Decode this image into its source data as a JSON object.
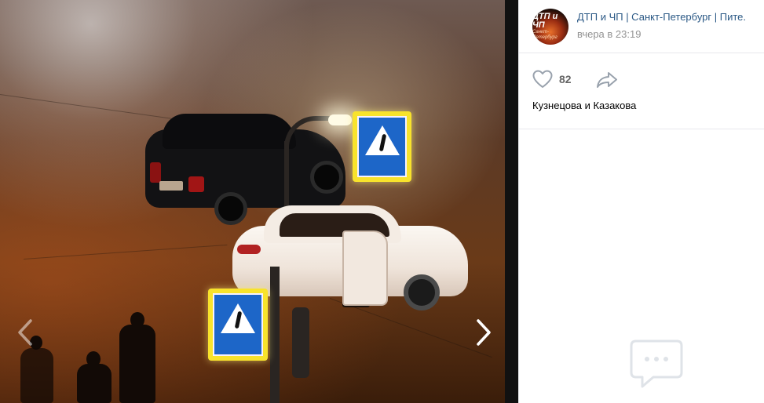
{
  "post": {
    "group_name": "ДТП и ЧП | Санкт-Петербург | Пите.",
    "time": "вчера в 23:19",
    "avatar": {
      "line1": "ДТП и ЧП",
      "line2": "Санкт-Петербург"
    }
  },
  "actions": {
    "like_count": "82",
    "likers": "Кузнецова и Казакова"
  },
  "icons": {
    "prev": "chevron-left-icon",
    "next": "chevron-right-icon",
    "like": "heart-icon",
    "share": "share-arrow-icon",
    "comments": "comment-bubble-icon"
  },
  "colors": {
    "link": "#2a5885",
    "muted": "#939393",
    "icon": "#99a2ad",
    "divider": "#e7e8ec"
  }
}
